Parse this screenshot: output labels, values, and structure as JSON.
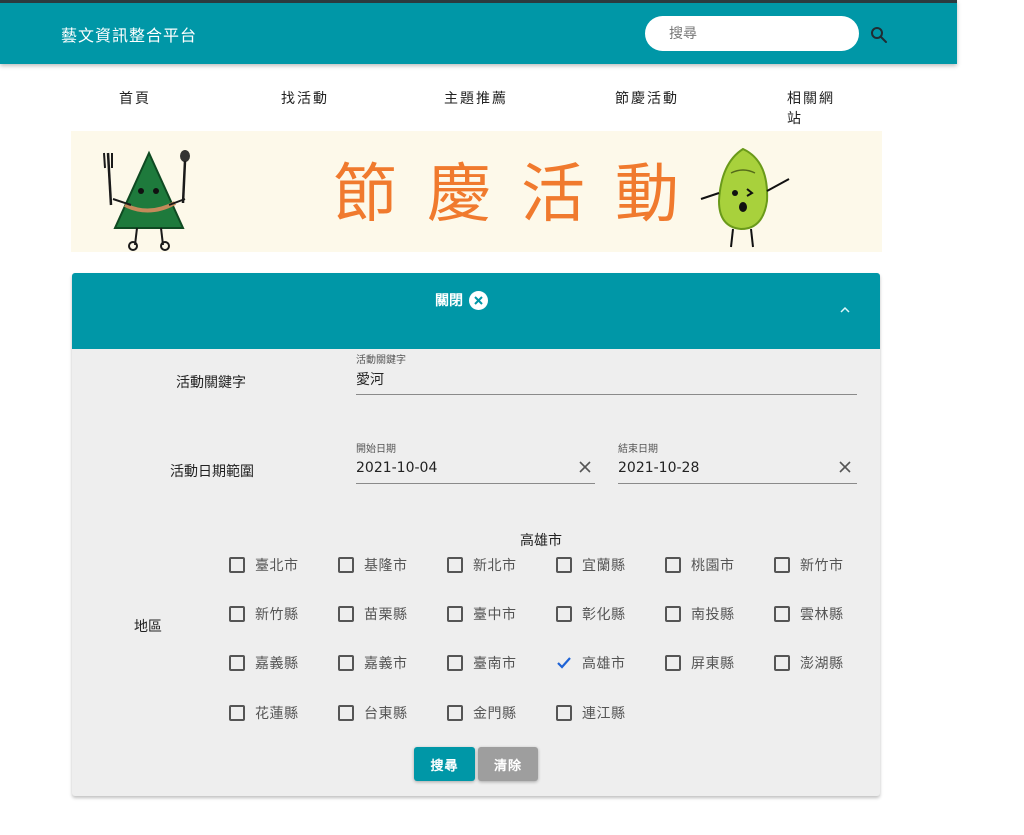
{
  "header": {
    "site_title": "藝文資訊整合平台",
    "search_placeholder": "搜尋",
    "color": "#0097a7"
  },
  "nav": {
    "items": [
      {
        "label": "首頁"
      },
      {
        "label": "找活動"
      },
      {
        "label": "主題推薦"
      },
      {
        "label": "節慶活動"
      },
      {
        "label": "相關網站"
      }
    ]
  },
  "banner": {
    "title": "節慶活動"
  },
  "filter_panel": {
    "toggle_label": "關閉",
    "keyword": {
      "row_label": "活動關鍵字",
      "field_label": "活動關鍵字",
      "value": "愛河"
    },
    "date_range": {
      "row_label": "活動日期範圍",
      "start_label": "開始日期",
      "start_value": "2021-10-04",
      "end_label": "結束日期",
      "end_value": "2021-10-28"
    },
    "region": {
      "row_label": "地區",
      "selected_summary": "高雄市",
      "options": [
        {
          "label": "臺北市",
          "checked": false
        },
        {
          "label": "基隆市",
          "checked": false
        },
        {
          "label": "新北市",
          "checked": false
        },
        {
          "label": "宜蘭縣",
          "checked": false
        },
        {
          "label": "桃園市",
          "checked": false
        },
        {
          "label": "新竹市",
          "checked": false
        },
        {
          "label": "新竹縣",
          "checked": false
        },
        {
          "label": "苗栗縣",
          "checked": false
        },
        {
          "label": "臺中市",
          "checked": false
        },
        {
          "label": "彰化縣",
          "checked": false
        },
        {
          "label": "南投縣",
          "checked": false
        },
        {
          "label": "雲林縣",
          "checked": false
        },
        {
          "label": "嘉義縣",
          "checked": false
        },
        {
          "label": "嘉義市",
          "checked": false
        },
        {
          "label": "臺南市",
          "checked": false
        },
        {
          "label": "高雄市",
          "checked": true
        },
        {
          "label": "屏東縣",
          "checked": false
        },
        {
          "label": "澎湖縣",
          "checked": false
        },
        {
          "label": "花蓮縣",
          "checked": false
        },
        {
          "label": "台東縣",
          "checked": false
        },
        {
          "label": "金門縣",
          "checked": false
        },
        {
          "label": "連江縣",
          "checked": false
        }
      ]
    },
    "buttons": {
      "search": "搜尋",
      "clear": "清除"
    },
    "checked_color": "#1e63d6"
  }
}
